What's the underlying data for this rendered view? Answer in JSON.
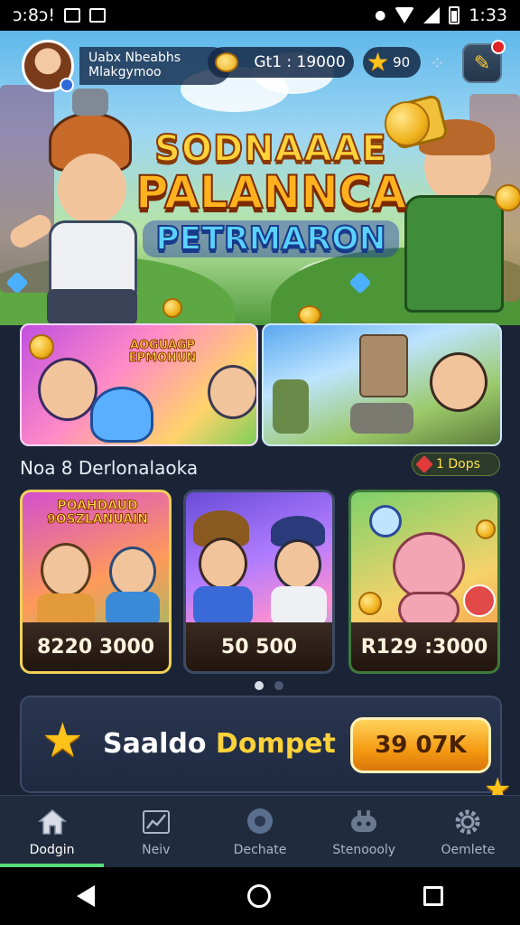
{
  "status_bar": {
    "time_left": "ↄ:8ↄ!",
    "time_right": "1:33"
  },
  "header": {
    "user_line1": "Uabx Nbeabhs",
    "user_line2": "Mlakgymoo",
    "coins": "Gt1 : 19000",
    "stars": "90",
    "dots": "⁘"
  },
  "hero": {
    "title_line1": "SODNAAAE",
    "title_line2": "PALANNCA",
    "title_line3": "PETRMARON"
  },
  "banners": [
    {
      "title": "AOGUAGP EPMOHUN"
    },
    {
      "title": ""
    }
  ],
  "section": {
    "title": "Noa 8 Derlonalaoka",
    "badge": "1 Dops"
  },
  "games": [
    {
      "title": "POAHDAUD 9OSZLANUAIN",
      "price": "8220 3000"
    },
    {
      "title": "",
      "price": "50 500"
    },
    {
      "title": "",
      "price": "R129 :3000"
    }
  ],
  "wallet": {
    "label_a": "Saaldo ",
    "label_b": "Dompet",
    "button": "39 07K"
  },
  "nav": [
    {
      "label": "Dodgin",
      "icon": "home-icon"
    },
    {
      "label": "Neiv",
      "icon": "chart-icon"
    },
    {
      "label": "Dechate",
      "icon": "chat-icon"
    },
    {
      "label": "Stenoooly",
      "icon": "controller-icon"
    },
    {
      "label": "Oemlete",
      "icon": "gear-icon"
    }
  ],
  "colors": {
    "accent": "#ffc21a",
    "nav_active": "#5adc7a",
    "bg": "#1b2437"
  }
}
